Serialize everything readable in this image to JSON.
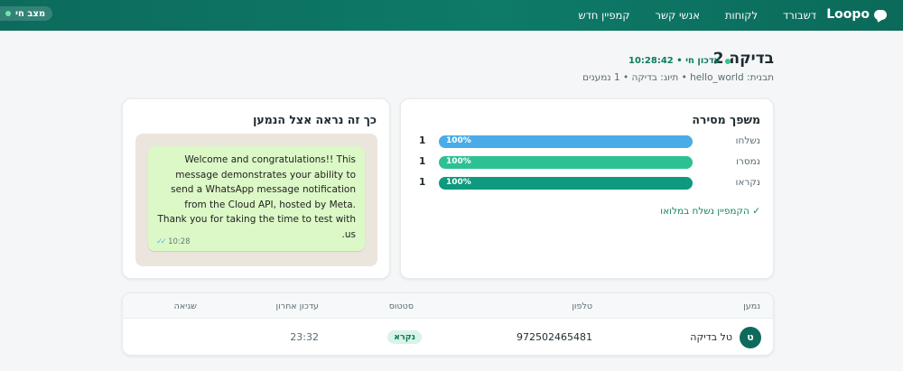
{
  "nav": {
    "brand": "Loopo",
    "links": [
      "דשבורד",
      "לקוחות",
      "אנשי קשר",
      "קמפיין חדש"
    ],
    "live_status": "מצב חי"
  },
  "header": {
    "title": "בדיקה 2",
    "live_update": "עדכון חי • 10:28:42",
    "subtitle": "תבנית: hello_world • תיוג: בדיקה • 1 נמענים"
  },
  "funnel": {
    "title": "משפך מסירה",
    "rows": [
      {
        "label": "נשלחו",
        "percent_text": "100%",
        "percent": 100,
        "count": "1",
        "color": "#4aace6"
      },
      {
        "label": "נמסרו",
        "percent_text": "100%",
        "percent": 100,
        "count": "1",
        "color": "#2cc093"
      },
      {
        "label": "נקראו",
        "percent_text": "100%",
        "percent": 100,
        "count": "1",
        "color": "#0d9a7e"
      }
    ],
    "status": "✓ הקמפיין נשלח במלואו"
  },
  "preview": {
    "title": "כך זה נראה אצל הנמען",
    "message": "Welcome and congratulations!! This message demonstrates your ability to send a WhatsApp message notification from the Cloud API, hosted by Meta. Thank you for taking the time to test with us.",
    "time": "10:28",
    "ticks": "✓✓"
  },
  "table": {
    "headers": [
      "נמען",
      "טלפון",
      "סטטוס",
      "עדכון אחרון",
      "שגיאה"
    ],
    "rows": [
      {
        "avatar": "ט",
        "name": "טל בדיקה",
        "phone": "972502465481",
        "status": "נקרא",
        "updated": "23:32",
        "error": ""
      }
    ]
  },
  "colors": {
    "nav": "#0e7a68",
    "accent": "#0e6b5c",
    "bar_sent": "#4aace6",
    "bar_delivered": "#2cc093",
    "bar_read": "#0d9a7e"
  }
}
